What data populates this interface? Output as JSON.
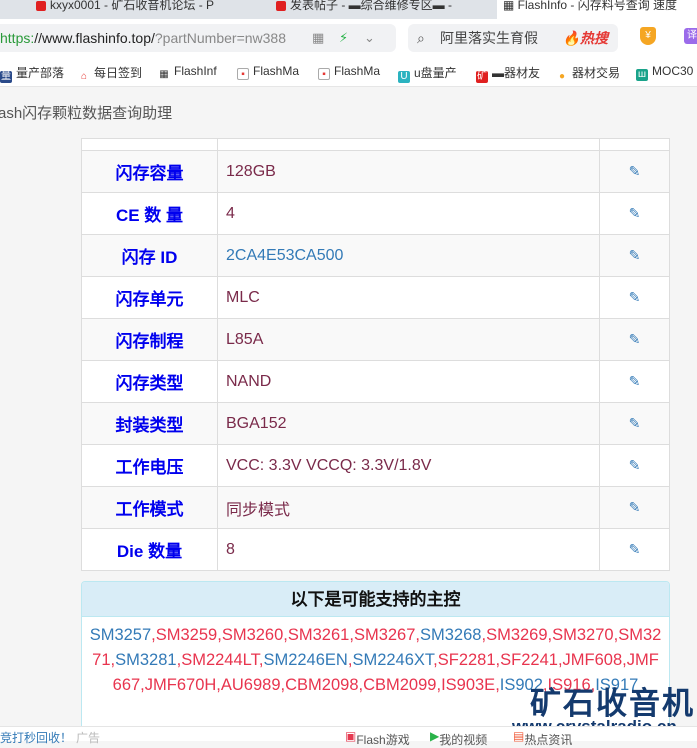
{
  "browser": {
    "tabs": [
      {
        "label": "kxyx0001 - 矿石收音机论坛 - P",
        "active": false
      },
      {
        "label": "发表帖子 - ▬综合维修专区▬ -",
        "active": false
      },
      {
        "label": "FlashInfo - 闪存料号查询 速度",
        "active": true
      }
    ],
    "url": {
      "scheme": "https:",
      "domain": "//www.flashinfo.top/",
      "rest": "?partNumber=nw388"
    },
    "search": {
      "value": "阿里落实生育假",
      "hot_label": "热搜"
    },
    "bookmarks": [
      "量产部落",
      "每日签到",
      "FlashInf",
      "FlashMa",
      "FlashMa",
      "u盘量产",
      "▬器材友",
      "器材交易",
      "MOC30"
    ]
  },
  "app_title": "ash闪存颗粒数据查询助理",
  "specs": [
    {
      "key": "闪存容量",
      "value": "128GB",
      "style": "plain"
    },
    {
      "key": "CE 数 量",
      "value": "4",
      "style": "plain"
    },
    {
      "key": "闪存 ID",
      "value": "2CA4E53CA500",
      "style": "blue"
    },
    {
      "key": "闪存单元",
      "value": "MLC",
      "style": "plain"
    },
    {
      "key": "闪存制程",
      "value": "L85A",
      "style": "plain"
    },
    {
      "key": "闪存类型",
      "value": "NAND",
      "style": "plain"
    },
    {
      "key": "封装类型",
      "value": "BGA152",
      "style": "plain"
    },
    {
      "key": "工作电压",
      "value": "VCC: 3.3V VCCQ: 3.3V/1.8V",
      "style": "plain"
    },
    {
      "key": "工作模式",
      "value": "同步模式",
      "style": "plain"
    },
    {
      "key": "Die 数量",
      "value": "8",
      "style": "plain"
    }
  ],
  "controllers_panel": {
    "title": "以下是可能支持的主控",
    "items": [
      {
        "name": "SM3257",
        "color": "blue"
      },
      {
        "name": "SM3259",
        "color": "red"
      },
      {
        "name": "SM3260",
        "color": "red"
      },
      {
        "name": "SM3261",
        "color": "red"
      },
      {
        "name": "SM3267",
        "color": "red"
      },
      {
        "name": "SM3268",
        "color": "blue"
      },
      {
        "name": "SM3269",
        "color": "red"
      },
      {
        "name": "SM3270",
        "color": "red"
      },
      {
        "name": "SM3271",
        "color": "red"
      },
      {
        "name": "SM3281",
        "color": "blue"
      },
      {
        "name": "SM2244LT",
        "color": "red"
      },
      {
        "name": "SM2246EN",
        "color": "blue"
      },
      {
        "name": "SM2246XT",
        "color": "blue"
      },
      {
        "name": "SF2281",
        "color": "red"
      },
      {
        "name": "SF2241",
        "color": "red"
      },
      {
        "name": "JMF608",
        "color": "red"
      },
      {
        "name": "JMF667",
        "color": "red"
      },
      {
        "name": "JMF670H",
        "color": "red"
      },
      {
        "name": "AU6989",
        "color": "red"
      },
      {
        "name": "CBM2098",
        "color": "red"
      },
      {
        "name": "CBM2099",
        "color": "red"
      },
      {
        "name": "IS903E",
        "color": "red"
      },
      {
        "name": "IS902",
        "color": "blue"
      },
      {
        "name": "IS916",
        "color": "red"
      },
      {
        "name": "IS917",
        "color": "blue"
      }
    ]
  },
  "status_bar": {
    "ad_text": "竞打秒回收！",
    "ad_tag": "广告",
    "items": [
      "Flash游戏",
      "我的视频",
      "热点资讯"
    ]
  },
  "watermark": {
    "title": "矿石收音机",
    "url": "www.crystalradio.cn"
  }
}
